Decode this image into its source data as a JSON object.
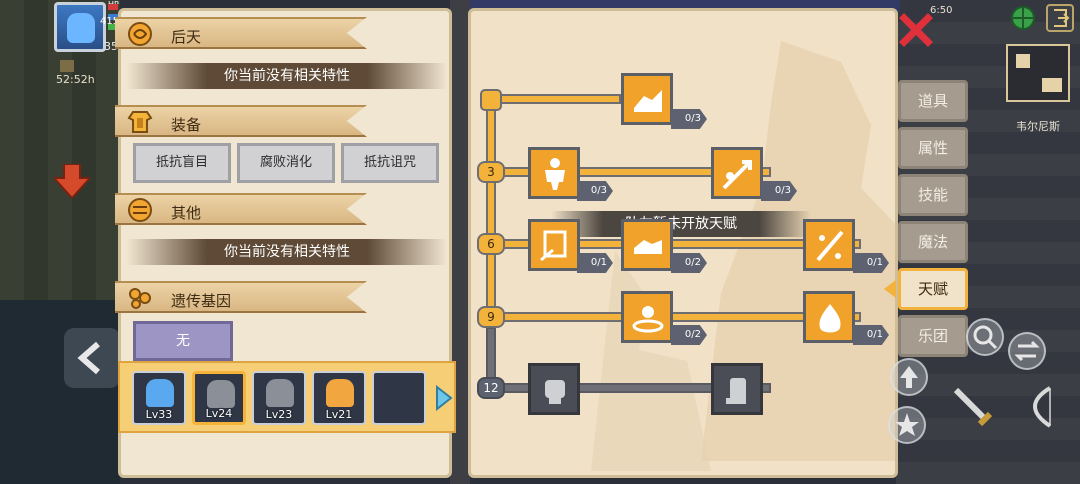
{
  "hud": {
    "hp_label": "HP",
    "hp_value": "415",
    "level": "35",
    "time_played": "52:52h",
    "clock": "6:50"
  },
  "left_panel": {
    "sections": [
      {
        "icon": "acquired-trait-icon",
        "title": "后天"
      },
      {
        "icon": "equipment-icon",
        "title": "装备"
      },
      {
        "icon": "other-icon",
        "title": "其他"
      },
      {
        "icon": "gene-icon",
        "title": "遗传基因"
      }
    ],
    "acquired_empty_text": "你当前没有相关特性",
    "other_empty_text": "你当前没有相关特性",
    "equipment_traits": [
      "抵抗盲目",
      "腐败消化",
      "抵抗诅咒"
    ],
    "gene_value": "无"
  },
  "team": {
    "members": [
      {
        "level": "Lv33",
        "hair": "#5aa8f0",
        "selected": false
      },
      {
        "level": "Lv24",
        "hair": "#8b8f98",
        "selected": true
      },
      {
        "level": "Lv23",
        "hair": "#8b8f98",
        "selected": false
      },
      {
        "level": "Lv21",
        "hair": "#f2a640",
        "selected": false
      }
    ]
  },
  "talent_tree": {
    "tier_labels": [
      "3",
      "6",
      "9",
      "12"
    ],
    "notice": "队友暂未开放天赋",
    "talents": [
      {
        "icon": "arm-wrestle-icon",
        "count": "0/3"
      },
      {
        "icon": "muscle-body-icon",
        "count": "0/3"
      },
      {
        "icon": "arrow-dodge-icon",
        "count": "0/3"
      },
      {
        "icon": "card-cycle-icon",
        "count": "0/1"
      },
      {
        "icon": "handshake-icon",
        "count": "0/2"
      },
      {
        "icon": "sword-slash-icon",
        "count": "0/1"
      },
      {
        "icon": "ground-pulse-icon",
        "count": "0/2"
      },
      {
        "icon": "flame-burst-icon",
        "count": "0/1"
      },
      {
        "icon": "fist-icon",
        "count": ""
      },
      {
        "icon": "fist-grip-icon",
        "count": ""
      }
    ]
  },
  "tabs": [
    {
      "label": "道具",
      "active": false
    },
    {
      "label": "属性",
      "active": false
    },
    {
      "label": "技能",
      "active": false
    },
    {
      "label": "魔法",
      "active": false
    },
    {
      "label": "天赋",
      "active": true
    },
    {
      "label": "乐团",
      "active": false
    }
  ],
  "map": {
    "location": "韦尔尼斯"
  },
  "colors": {
    "accent": "#f3b23a",
    "panel": "#f1e6d1",
    "tab_inactive": "#a59b8f",
    "close": "#e0303b"
  }
}
